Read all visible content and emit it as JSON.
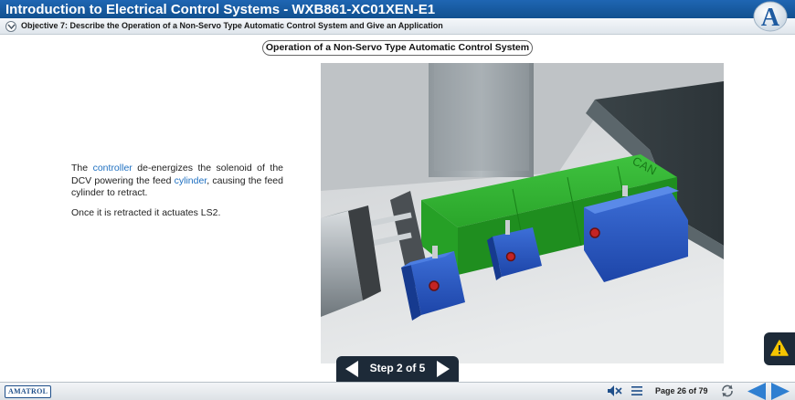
{
  "header": {
    "title": "Introduction to Electrical Control Systems - WXB861-XC01XEN-E1",
    "logo_letter": "A"
  },
  "objective": {
    "text": "Objective 7: Describe the Operation of a Non-Servo Type Automatic Control System and Give an Application"
  },
  "section": {
    "title": "Operation of a Non-Servo Type Automatic Control System"
  },
  "content": {
    "p1_before": "The ",
    "p1_link1": "controller",
    "p1_middle": " de-energizes the solenoid of the DCV powering the feed ",
    "p1_link2": "cylinder",
    "p1_after": ", causing the feed cylinder to retract.",
    "p2": "Once it is retracted it actuates LS2."
  },
  "scene": {
    "can_label": "CAN"
  },
  "step_nav": {
    "label": "Step 2 of 5"
  },
  "footer": {
    "brand": "AMATROL",
    "page_label": "Page 26 of 79"
  },
  "colors": {
    "title_bar": "#1a5ea6",
    "link": "#1f70c1",
    "nav_dark": "#1d2a38",
    "page_arrows": "#2f7fd1"
  }
}
